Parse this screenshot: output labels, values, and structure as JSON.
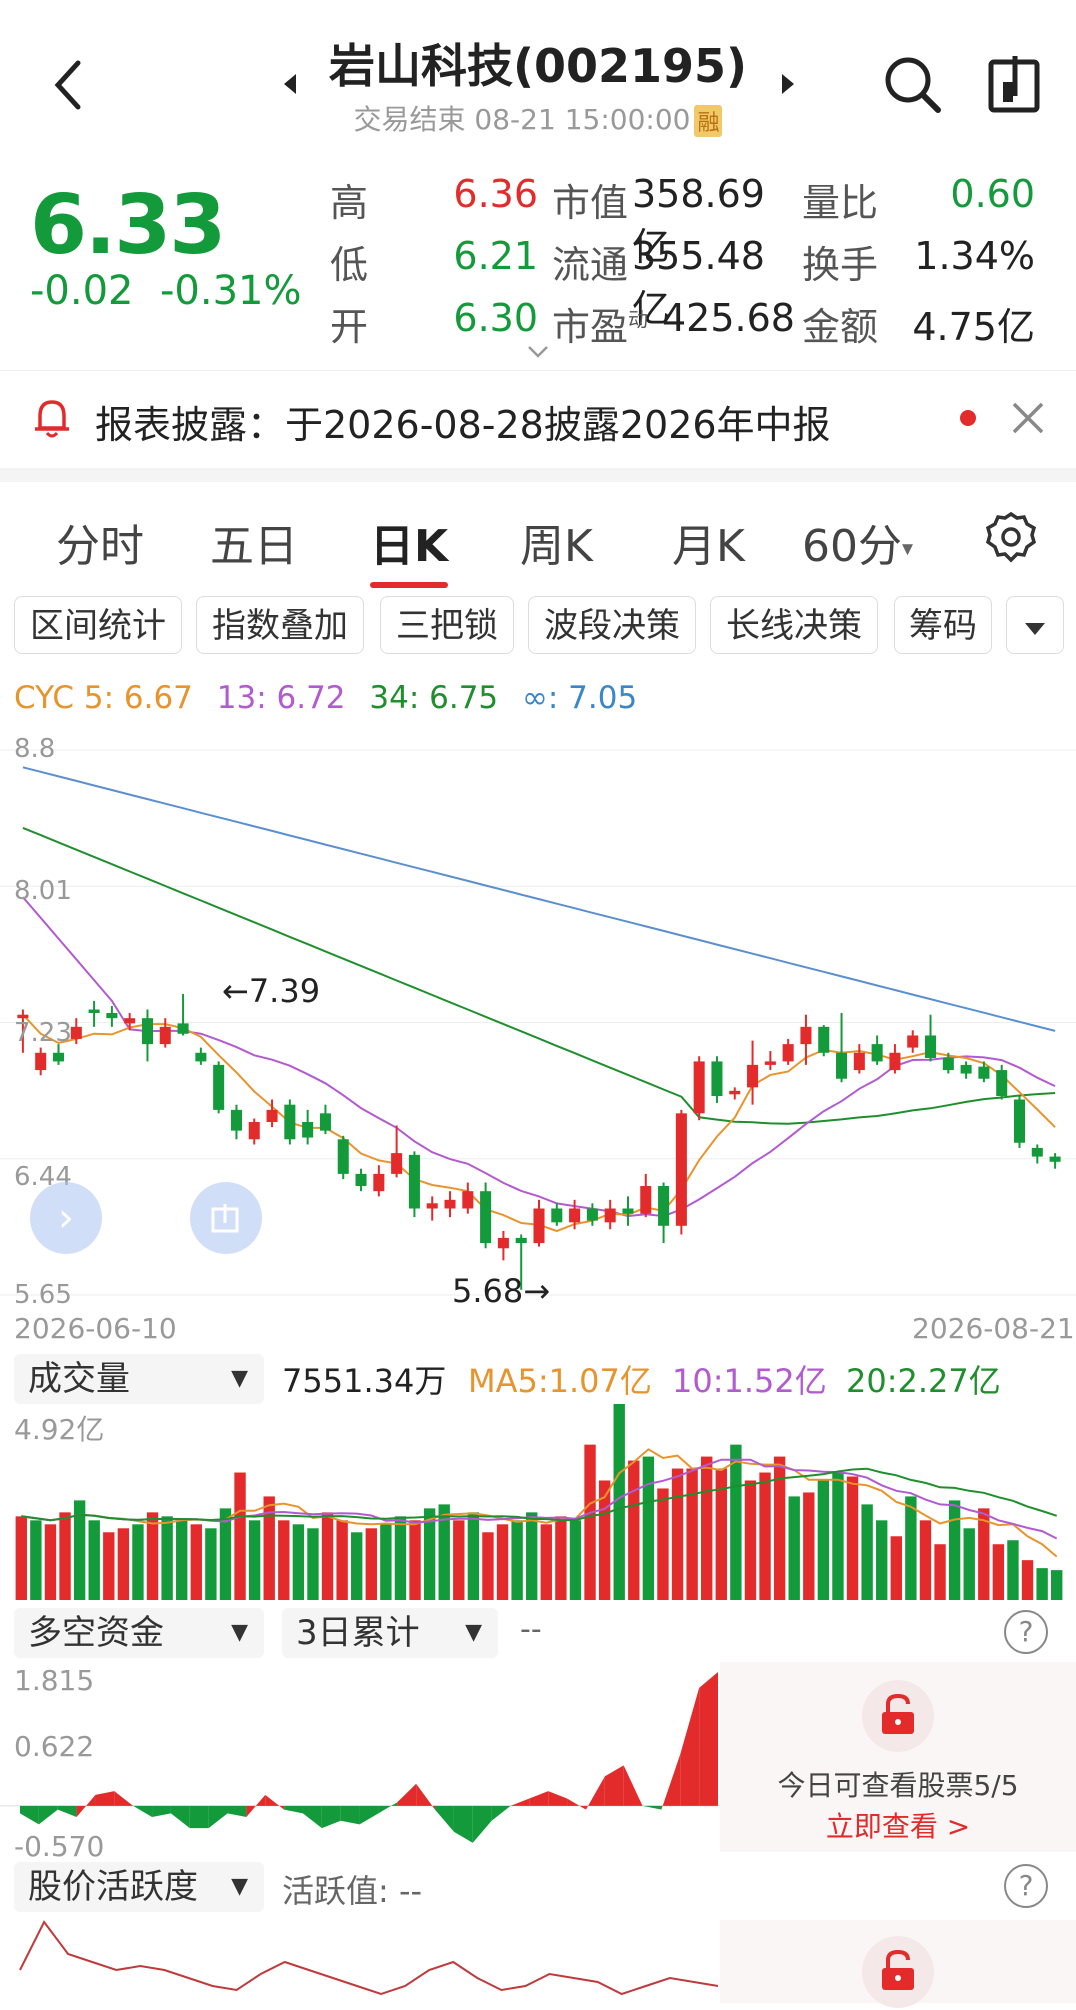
{
  "header": {
    "title": "岩山科技(002195)",
    "status": "交易结束 08-21 15:00:00",
    "badge": "融"
  },
  "quote": {
    "price": "6.33",
    "change": "-0.02",
    "change_pct": "-0.31%",
    "rows": [
      {
        "l1": "高",
        "v1": "6.36",
        "l2": "市值",
        "v2": "358.69亿",
        "l3": "量比",
        "v3": "0.60"
      },
      {
        "l1": "低",
        "v1": "6.21",
        "l2": "流通",
        "v2": "355.48亿",
        "l3": "换手",
        "v3": "1.34%"
      },
      {
        "l1": "开",
        "v1": "6.30",
        "l2": "市盈",
        "l2_sup": "动",
        "v2": "425.68",
        "l3": "金额",
        "v3": "4.75亿"
      }
    ]
  },
  "notice": {
    "text": "报表披露：于2026-08-28披露2026年中报"
  },
  "tabs": [
    "分时",
    "五日",
    "日K",
    "周K",
    "月K",
    "60分"
  ],
  "active_tab": "日K",
  "tools": [
    "区间统计",
    "指数叠加",
    "三把锁",
    "波段决策",
    "长线决策",
    "筹码"
  ],
  "cyc": {
    "label": "CYC 5: 6.67",
    "l13": "13: 6.72",
    "l34": "34: 6.75",
    "linf": "∞: 7.05"
  },
  "kline": {
    "y_ticks": [
      "8.8",
      "8.01",
      "7.23",
      "6.44",
      "5.65"
    ],
    "high_note": "7.39",
    "low_note": "5.68",
    "date_start": "2026-06-10",
    "date_end": "2026-08-21"
  },
  "volume": {
    "selector": "成交量",
    "value": "7551.34万",
    "ma5": "MA5:1.07亿",
    "ma10": "10:1.52亿",
    "ma20": "20:2.27亿",
    "top": "4.92亿"
  },
  "fund": {
    "selector": "多空资金",
    "period": "3日累计",
    "value": "--",
    "ticks": [
      "1.815",
      "0.622",
      "-0.570"
    ],
    "lock_text": "今日可查看股票5/5",
    "lock_link": "立即查看 >"
  },
  "activity": {
    "selector": "股价活跃度",
    "label": "活跃值: --"
  },
  "colors": {
    "up": "#e32b2b",
    "down": "#139a3a",
    "ma5": "#e8942c",
    "ma13": "#b25bd0",
    "ma34": "#1f8f2e",
    "mainf": "#5b8fd0"
  },
  "chart_data": {
    "type": "candlestick",
    "title": "",
    "x_range": [
      "2026-06-10",
      "2026-08-21"
    ],
    "ylim": [
      5.65,
      8.8
    ],
    "candles": [
      [
        7.25,
        7.27,
        7.05,
        7.3
      ],
      [
        6.95,
        7.05,
        6.92,
        7.08
      ],
      [
        7.05,
        7.0,
        6.98,
        7.1
      ],
      [
        7.13,
        7.2,
        7.1,
        7.25
      ],
      [
        7.3,
        7.28,
        7.2,
        7.35
      ],
      [
        7.28,
        7.25,
        7.2,
        7.32
      ],
      [
        7.22,
        7.25,
        7.18,
        7.28
      ],
      [
        7.25,
        7.1,
        7.0,
        7.3
      ],
      [
        7.1,
        7.2,
        7.08,
        7.25
      ],
      [
        7.22,
        7.16,
        7.15,
        7.39
      ],
      [
        7.05,
        7.0,
        6.98,
        7.08
      ],
      [
        6.98,
        6.72,
        6.7,
        7.0
      ],
      [
        6.72,
        6.6,
        6.55,
        6.75
      ],
      [
        6.55,
        6.65,
        6.52,
        6.67
      ],
      [
        6.65,
        6.72,
        6.62,
        6.78
      ],
      [
        6.75,
        6.55,
        6.52,
        6.78
      ],
      [
        6.65,
        6.56,
        6.52,
        6.72
      ],
      [
        6.7,
        6.6,
        6.58,
        6.75
      ],
      [
        6.55,
        6.35,
        6.32,
        6.57
      ],
      [
        6.35,
        6.28,
        6.25,
        6.38
      ],
      [
        6.25,
        6.35,
        6.22,
        6.4
      ],
      [
        6.35,
        6.47,
        6.33,
        6.63
      ],
      [
        6.46,
        6.15,
        6.1,
        6.48
      ],
      [
        6.15,
        6.18,
        6.08,
        6.22
      ],
      [
        6.15,
        6.2,
        6.1,
        6.25
      ],
      [
        6.15,
        6.25,
        6.12,
        6.3
      ],
      [
        6.25,
        5.95,
        5.92,
        6.3
      ],
      [
        5.92,
        5.98,
        5.85,
        6.02
      ],
      [
        5.98,
        5.95,
        5.68,
        6.0
      ],
      [
        5.95,
        6.15,
        5.93,
        6.2
      ],
      [
        6.15,
        6.07,
        6.05,
        6.18
      ],
      [
        6.07,
        6.15,
        6.03,
        6.2
      ],
      [
        6.15,
        6.08,
        6.05,
        6.18
      ],
      [
        6.07,
        6.15,
        6.03,
        6.2
      ],
      [
        6.15,
        6.12,
        6.05,
        6.22
      ],
      [
        6.12,
        6.28,
        6.1,
        6.35
      ],
      [
        6.28,
        6.05,
        5.95,
        6.3
      ],
      [
        6.05,
        6.7,
        6.0,
        6.72
      ],
      [
        6.7,
        7.0,
        6.66,
        7.03
      ],
      [
        7.0,
        6.8,
        6.76,
        7.03
      ],
      [
        6.81,
        6.83,
        6.78,
        6.85
      ],
      [
        6.85,
        6.98,
        6.75,
        7.12
      ],
      [
        6.98,
        7.0,
        6.95,
        7.06
      ],
      [
        7.0,
        7.1,
        6.98,
        7.13
      ],
      [
        7.1,
        7.2,
        6.98,
        7.27
      ],
      [
        7.2,
        7.05,
        7.03,
        7.21
      ],
      [
        7.05,
        6.9,
        6.88,
        7.28
      ],
      [
        6.95,
        7.05,
        6.93,
        7.1
      ],
      [
        7.1,
        7.0,
        6.98,
        7.15
      ],
      [
        6.95,
        7.05,
        6.93,
        7.1
      ],
      [
        7.08,
        7.15,
        7.05,
        7.18
      ],
      [
        7.15,
        7.02,
        7.0,
        7.27
      ],
      [
        7.02,
        6.95,
        6.93,
        7.05
      ],
      [
        6.98,
        6.93,
        6.9,
        7.0
      ],
      [
        6.97,
        6.9,
        6.88,
        7.0
      ],
      [
        6.95,
        6.8,
        6.78,
        6.98
      ],
      [
        6.78,
        6.53,
        6.5,
        6.8
      ],
      [
        6.5,
        6.45,
        6.41,
        6.52
      ],
      [
        6.45,
        6.42,
        6.38,
        6.47
      ]
    ],
    "volume": [
      2.1,
      2.0,
      1.9,
      2.2,
      2.5,
      2.0,
      1.7,
      1.8,
      1.9,
      2.2,
      2.1,
      2.0,
      1.9,
      1.8,
      2.3,
      3.2,
      2.0,
      2.6,
      2.0,
      1.9,
      1.8,
      2.2,
      2.0,
      1.7,
      1.8,
      1.9,
      2.1,
      2.0,
      2.3,
      2.4,
      2.0,
      2.2,
      1.7,
      1.9,
      2.0,
      2.2,
      1.9,
      2.1,
      2.0,
      3.9,
      3.0,
      4.92,
      3.5,
      3.6,
      2.8,
      3.3,
      3.3,
      3.6,
      3.3,
      3.9,
      3.0,
      3.2,
      3.6,
      2.6,
      2.7,
      3.0,
      3.2,
      3.1,
      2.4,
      2.0,
      1.6,
      2.6,
      2.0,
      1.4,
      2.5,
      1.8,
      2.3,
      1.4,
      1.5,
      1.0,
      0.8,
      0.75
    ],
    "fund_flow": [
      -0.1,
      -0.25,
      -0.05,
      -0.15,
      0.15,
      0.2,
      0.0,
      -0.15,
      -0.1,
      -0.3,
      -0.3,
      -0.1,
      -0.15,
      0.15,
      -0.05,
      -0.1,
      -0.3,
      -0.2,
      -0.25,
      -0.1,
      0.05,
      0.3,
      -0.05,
      -0.35,
      -0.5,
      -0.2,
      0.0,
      0.1,
      0.2,
      0.1,
      -0.05,
      0.4,
      0.55,
      0.0,
      -0.05,
      0.7,
      1.6,
      1.815
    ],
    "activity": [
      0.4,
      1.0,
      0.6,
      0.5,
      0.4,
      0.45,
      0.4,
      0.3,
      0.2,
      0.15,
      0.35,
      0.5,
      0.4,
      0.3,
      0.2,
      0.1,
      0.2,
      0.4,
      0.5,
      0.3,
      0.15,
      0.2,
      0.35,
      0.3,
      0.25,
      0.1,
      0.2,
      0.3,
      0.25,
      0.2
    ]
  }
}
